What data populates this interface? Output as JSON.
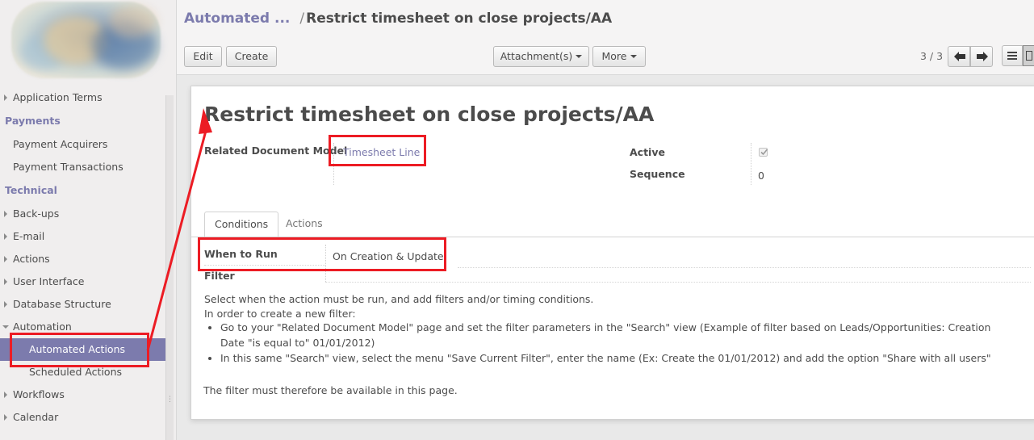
{
  "sidebar": {
    "menu": [
      {
        "kind": "item",
        "label": "Application Terms",
        "caret": "right"
      },
      {
        "kind": "section",
        "label": "Payments"
      },
      {
        "kind": "item",
        "label": "Payment Acquirers"
      },
      {
        "kind": "item",
        "label": "Payment Transactions"
      },
      {
        "kind": "section",
        "label": "Technical"
      },
      {
        "kind": "item",
        "label": "Back-ups",
        "caret": "right"
      },
      {
        "kind": "item",
        "label": "E-mail",
        "caret": "right"
      },
      {
        "kind": "item",
        "label": "Actions",
        "caret": "right"
      },
      {
        "kind": "item",
        "label": "User Interface",
        "caret": "right"
      },
      {
        "kind": "item",
        "label": "Database Structure",
        "caret": "right"
      },
      {
        "kind": "item",
        "label": "Automation",
        "caret": "down"
      },
      {
        "kind": "sub",
        "label": "Automated Actions",
        "active": true
      },
      {
        "kind": "sub",
        "label": "Scheduled Actions"
      },
      {
        "kind": "item",
        "label": "Workflows",
        "caret": "right"
      },
      {
        "kind": "item",
        "label": "Calendar",
        "caret": "right"
      }
    ]
  },
  "header": {
    "breadcrumb_parent": "Automated ...",
    "breadcrumb_sep": "/",
    "breadcrumb_current": "Restrict timesheet on close projects/AA",
    "edit_label": "Edit",
    "create_label": "Create",
    "attachments_label": "Attachment(s)",
    "more_label": "More",
    "pager": "3 / 3"
  },
  "form": {
    "title": "Restrict timesheet on close projects/AA",
    "related_model_label": "Related Document Model",
    "related_model_value": "Timesheet Line",
    "active_label": "Active",
    "active_checked": true,
    "sequence_label": "Sequence",
    "sequence_value": "0",
    "tabs": [
      "Conditions",
      "Actions"
    ],
    "when_to_run_label": "When to Run",
    "when_to_run_value": "On Creation & Update",
    "filter_label": "Filter",
    "help_line1": "Select when the action must be run, and add filters and/or timing conditions.",
    "help_line2": "In order to create a new filter:",
    "bullet1": "Go to your \"Related Document Model\" page and set the filter parameters in the \"Search\" view (Example of filter based on Leads/Opportunities: Creation Date \"is equal to\" 01/01/2012)",
    "bullet2": "In this same \"Search\" view, select the menu \"Save Current Filter\", enter the name (Ex: Create the 01/01/2012) and add the option \"Share with all users\"",
    "help_footer": "The filter must therefore be available in this page."
  },
  "annotations": {
    "color": "#ec1c24"
  }
}
